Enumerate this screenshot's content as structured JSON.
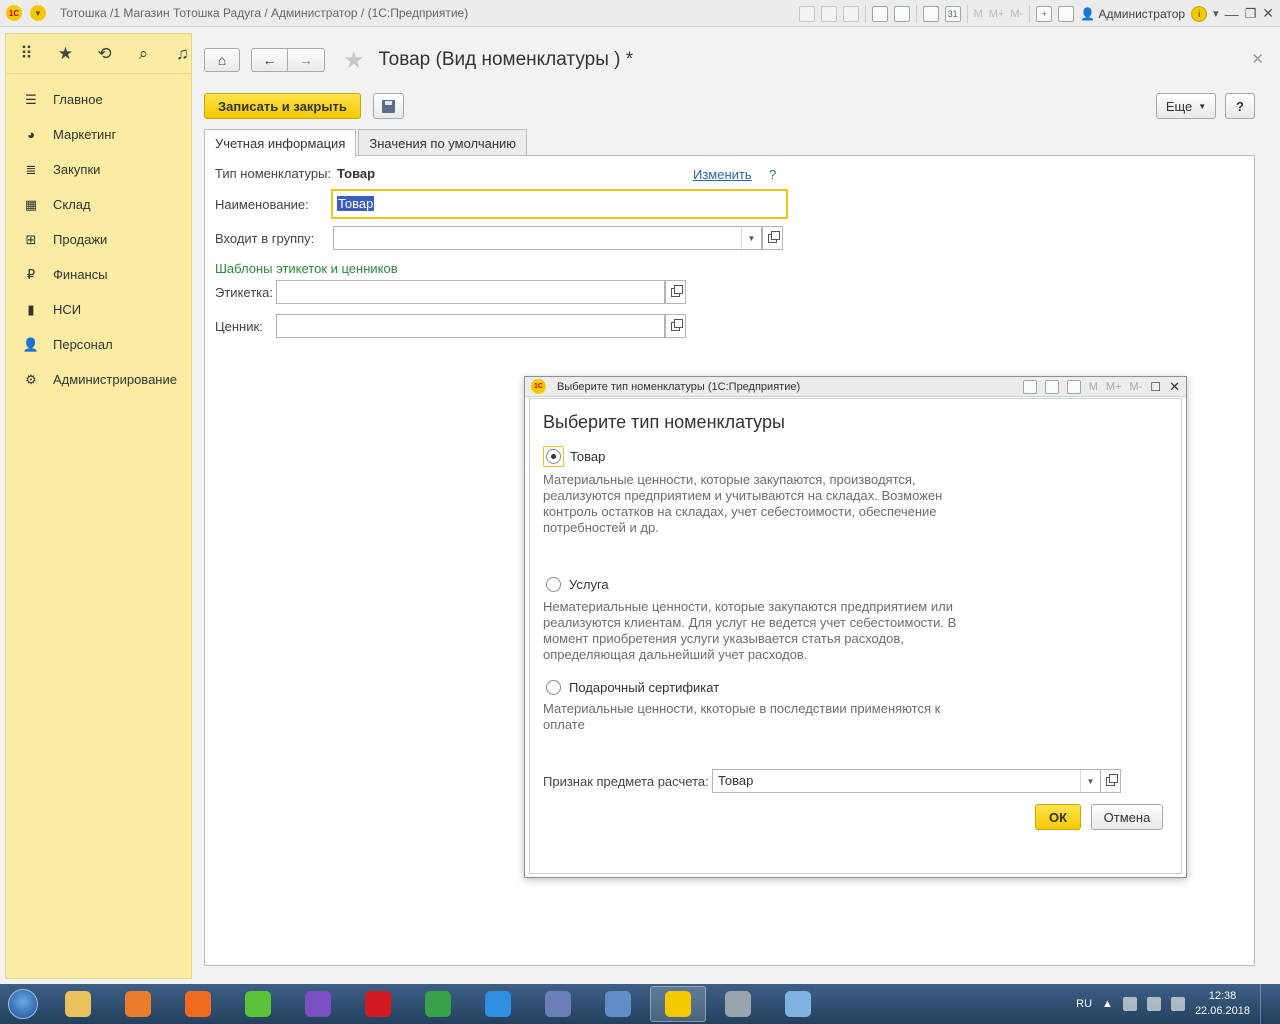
{
  "window": {
    "logo_text": "1С",
    "title": "Тотошка /1 Магазин Тотошка Радуга / Администратор /  (1С:Предприятие)",
    "user": "Администратор",
    "toolbar_marks": [
      "M",
      "M+",
      "M-"
    ]
  },
  "sidebar": {
    "items": [
      {
        "label": "Главное",
        "icon": "menu-lines-icon"
      },
      {
        "label": "Маркетинг",
        "icon": "pie-chart-icon"
      },
      {
        "label": "Закупки",
        "icon": "list-icon"
      },
      {
        "label": "Склад",
        "icon": "warehouse-icon"
      },
      {
        "label": "Продажи",
        "icon": "basket-icon"
      },
      {
        "label": "Финансы",
        "icon": "ruble-coin-icon"
      },
      {
        "label": "НСИ",
        "icon": "book-icon"
      },
      {
        "label": "Персонал",
        "icon": "person-icon"
      },
      {
        "label": "Администрирование",
        "icon": "gear-icon"
      }
    ]
  },
  "form": {
    "title": "Товар (Вид номенклатуры ) *",
    "save_close_label": "Записать и закрыть",
    "more_label": "Еще",
    "help_label": "?",
    "tabs": [
      {
        "label": "Учетная информация",
        "active": true
      },
      {
        "label": "Значения по умолчанию",
        "active": false
      }
    ],
    "type_label": "Тип номенклатуры:",
    "type_value": "Товар",
    "change_link": "Изменить",
    "question": "?",
    "name_label": "Наименование:",
    "name_value": "Товар",
    "group_label": "Входит в группу:",
    "group_value": "",
    "templates_title": "Шаблоны этикеток и ценников",
    "label_label": "Этикетка:",
    "label_value": "",
    "price_tag_label": "Ценник:",
    "price_tag_value": ""
  },
  "dialog": {
    "window_title": "Выберите тип номенклатуры  (1С:Предприятие)",
    "heading": "Выберите тип номенклатуры",
    "options": [
      {
        "label": "Товар",
        "selected": true,
        "description": "Материальные ценности, которые закупаются, производятся, реализуются предприятием и учитываются на складах. Возможен контроль остатков на складах, учет себестоимости, обеспечение потребностей и др."
      },
      {
        "label": "Услуга",
        "selected": false,
        "description": "Нематериальные ценности, которые закупаются предприятием или реализуются клиентам. Для услуг не ведется учет себестоимости. В момент приобретения услуги указывается статья расходов, определяющая дальнейший учет расходов."
      },
      {
        "label": "Подарочный сертификат",
        "selected": false,
        "description": "Материальные ценности, ккоторые в последствии применяются к оплате"
      }
    ],
    "subject_label": "Признак предмета расчета:",
    "subject_value": "Товар",
    "ok_label": "ОК",
    "cancel_label": "Отмена"
  },
  "taskbar": {
    "apps": [
      {
        "name": "file-explorer",
        "color": "#e8c25a"
      },
      {
        "name": "media-player",
        "color": "#e87d2c"
      },
      {
        "name": "firefox",
        "color": "#f06a20"
      },
      {
        "name": "icq",
        "color": "#5cc23a"
      },
      {
        "name": "viber",
        "color": "#7a4fc1"
      },
      {
        "name": "opera",
        "color": "#d41a20"
      },
      {
        "name": "chrome",
        "color": "#39a04a"
      },
      {
        "name": "internet-explorer",
        "color": "#2f8ee0"
      },
      {
        "name": "floppy-app",
        "color": "#6b7fb6"
      },
      {
        "name": "remote-desktop",
        "color": "#5f8ec7"
      },
      {
        "name": "1c-enterprise",
        "color": "#f5c900"
      },
      {
        "name": "camera-app",
        "color": "#9aa4ae"
      },
      {
        "name": "notepad-app",
        "color": "#7fb3e0"
      }
    ],
    "lang": "RU",
    "time": "12:38",
    "date": "22.06.2018"
  }
}
